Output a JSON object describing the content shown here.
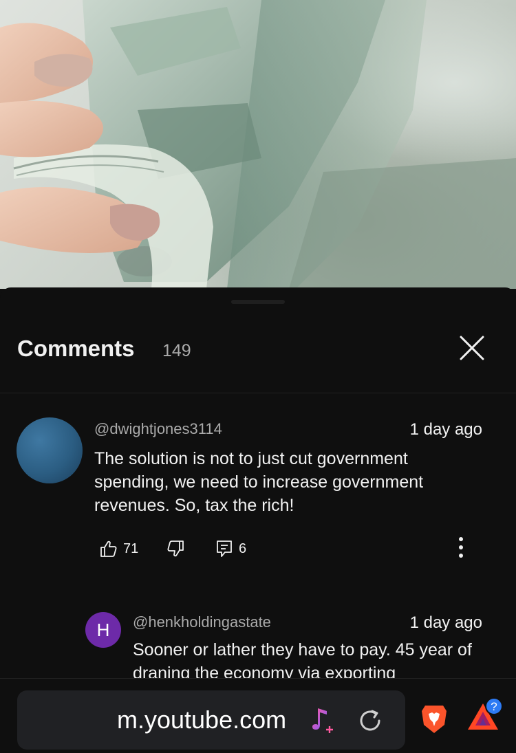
{
  "video": {
    "thumbnail_icon": "money-cash-image"
  },
  "comments_panel": {
    "title": "Comments",
    "count": "149",
    "close_icon": "close-icon"
  },
  "comment": {
    "handle": "@dwightjones3114",
    "time": "1 day ago",
    "text": "The solution is not to just cut government spending, we need to increase government revenues. So, tax the rich!",
    "likes": "71",
    "replies": "6",
    "avatar_color": "#2b5d82"
  },
  "reply": {
    "avatar_letter": "H",
    "avatar_color": "#6d2aa8",
    "handle": "@henkholdingastate",
    "time": "1 day ago",
    "text": "Sooner or lather they have to pay. 45 year of draning the economy via exporting"
  },
  "browser": {
    "url": "m.youtube.com",
    "badge": "?"
  }
}
